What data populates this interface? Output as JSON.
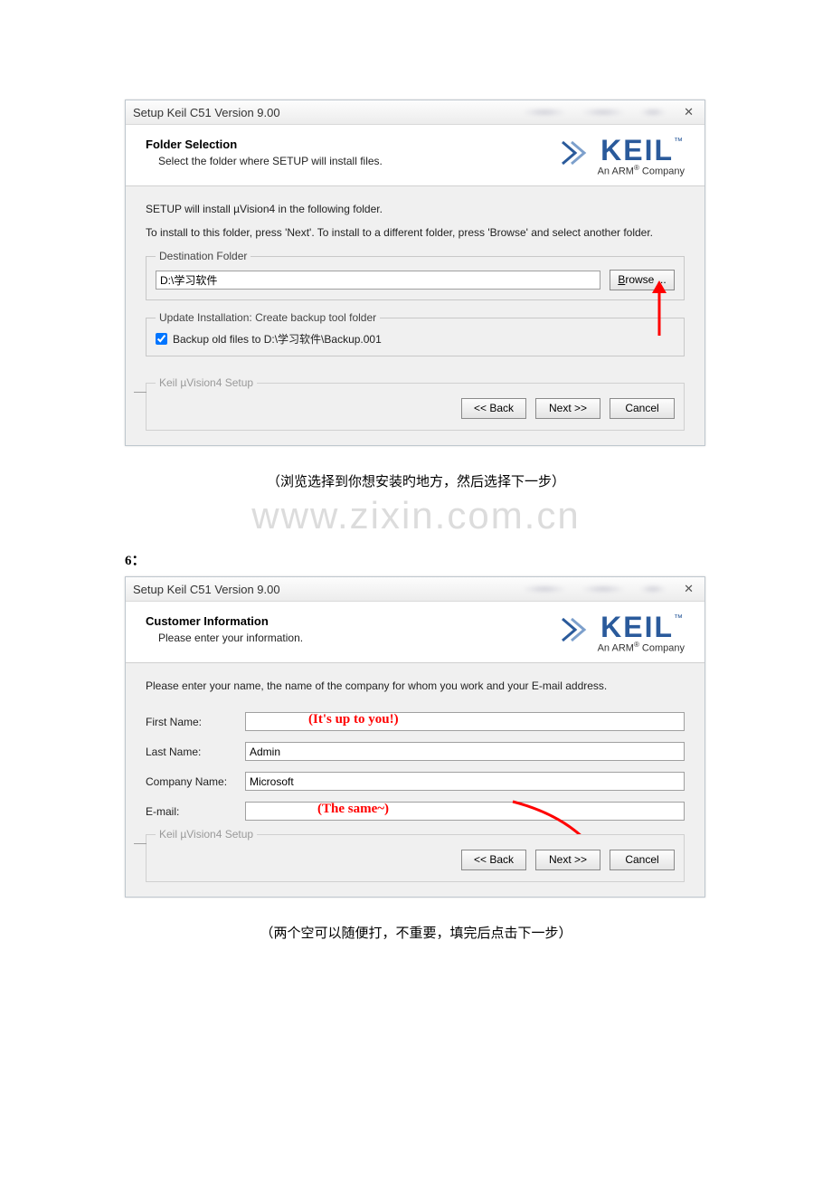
{
  "dialog1": {
    "window_title": "Setup Keil C51 Version 9.00",
    "close_glyph": "✕",
    "header_title": "Folder Selection",
    "header_sub": "Select the folder where SETUP will install files.",
    "logo_text": "KEIL",
    "logo_tm": "™",
    "logo_sub_prefix": "An ARM",
    "logo_sub_reg": "®",
    "logo_sub_suffix": " Company",
    "body_line1": "SETUP will install µVision4 in the following folder.",
    "body_line2": "To install to this folder, press 'Next'. To install to a different folder, press 'Browse' and select another folder.",
    "fieldset_dest": "Destination Folder",
    "path_value": "D:\\学习软件",
    "browse_prefix": "B",
    "browse_rest": "rowse ...",
    "fieldset_update": "Update Installation: Create backup tool folder",
    "backup_label": "Backup old files to D:\\学习软件\\Backup.001",
    "footer_legend": "Keil µVision4 Setup",
    "back_btn": "<< Back",
    "next_btn": "Next >>",
    "cancel_btn": "Cancel"
  },
  "caption1": "（浏览选择到你想安装旳地方，然后选择下一步）",
  "watermark": "www.zixin.com.cn",
  "step6": "6：",
  "dialog2": {
    "window_title": "Setup Keil C51 Version 9.00",
    "header_title": "Customer Information",
    "header_sub": "Please enter your information.",
    "body_line": "Please enter your name, the name of the company for whom you work and your E-mail address.",
    "first_label": "First Name:",
    "first_overlay": "(It's up to you!)",
    "last_label": "Last Name:",
    "last_value": "Admin",
    "company_label": "Company Name:",
    "company_value": "Microsoft",
    "email_label": "E-mail:",
    "email_overlay": "(The same~)",
    "footer_legend": "Keil µVision4 Setup",
    "back_btn": "<< Back",
    "next_btn": "Next >>",
    "cancel_btn": "Cancel"
  },
  "caption2": "（两个空可以随便打，不重要，填完后点击下一步）"
}
